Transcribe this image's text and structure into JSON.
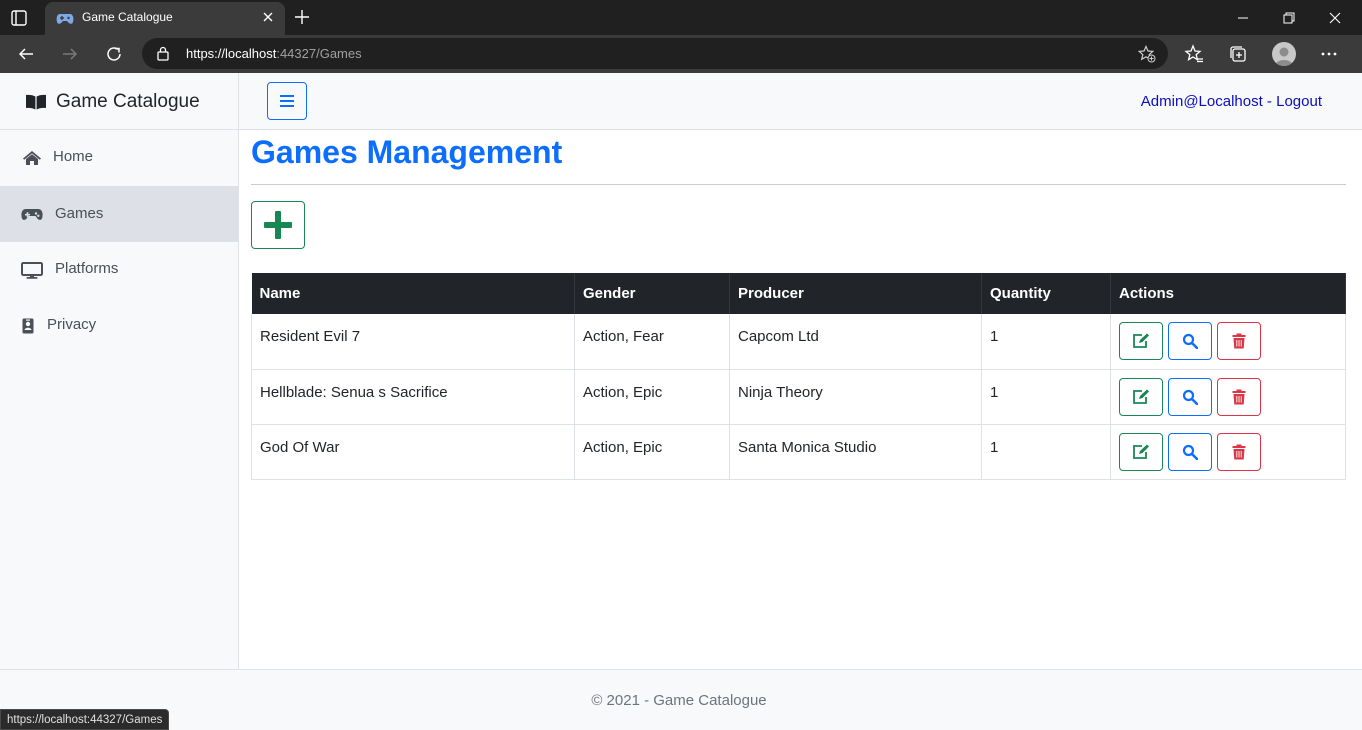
{
  "browser": {
    "tab_title": "Game Catalogue",
    "url_scheme": "https://",
    "url_host": "localhost",
    "url_rest": ":44327/Games",
    "status_url": "https://localhost:44327/Games"
  },
  "sidebar": {
    "brand": "Game Catalogue",
    "items": [
      {
        "label": "Home",
        "icon": "home-icon",
        "active": false
      },
      {
        "label": "Games",
        "icon": "gamepad-icon",
        "active": true
      },
      {
        "label": "Platforms",
        "icon": "monitor-icon",
        "active": false
      },
      {
        "label": "Privacy",
        "icon": "id-badge-icon",
        "active": false
      }
    ]
  },
  "topnav": {
    "user": "Admin@Localhost",
    "separator": " - ",
    "logout": "Logout"
  },
  "main": {
    "title": "Games Management",
    "table": {
      "headers": [
        "Name",
        "Gender",
        "Producer",
        "Quantity",
        "Actions"
      ],
      "rows": [
        [
          "Resident Evil 7",
          "Action, Fear",
          "Capcom Ltd",
          "1"
        ],
        [
          "Hellblade: Senua s Sacrifice",
          "Action, Epic",
          "Ninja Theory",
          "1"
        ],
        [
          "God Of War",
          "Action, Epic",
          "Santa Monica Studio",
          "1"
        ]
      ]
    }
  },
  "footer": {
    "text": "© 2021 - Game Catalogue"
  },
  "colors": {
    "primary": "#0d6efd",
    "success": "#198754",
    "danger": "#dc3545",
    "table_header": "#212529"
  }
}
